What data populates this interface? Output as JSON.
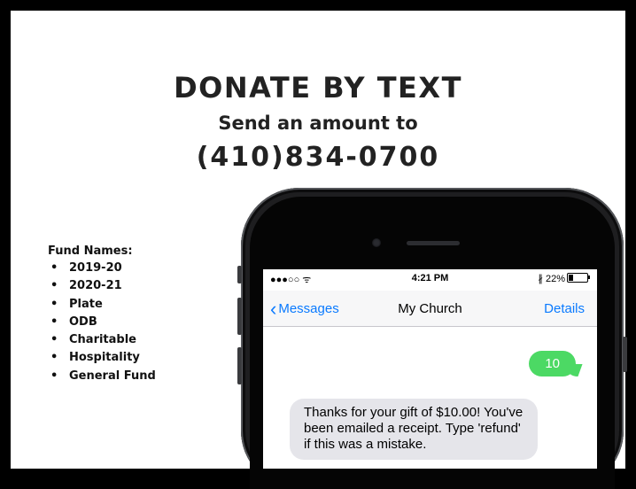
{
  "slide": {
    "heading": "DONATE BY TEXT",
    "subheading": "Send an amount to",
    "phone_number": "(410)834-0700"
  },
  "funds": {
    "title": "Fund Names:",
    "items": [
      "2019-20",
      "2020-21",
      "Plate",
      "ODB",
      "Charitable",
      "Hospitality",
      "General Fund"
    ]
  },
  "phone_screen": {
    "status": {
      "signal": "●●●○○ ᯤ",
      "time": "4:21 PM",
      "battery": "∦ 22%"
    },
    "nav": {
      "back_label": "Messages",
      "title": "My Church",
      "details_label": "Details"
    },
    "messages": {
      "outgoing": "10",
      "incoming": "Thanks for your gift of $10.00! You've been emailed a receipt. Type 'refund' if this was a mistake."
    }
  },
  "colors": {
    "ios_blue": "#0a7aff",
    "sent_bubble": "#4cd964",
    "received_bubble": "#e5e5ea",
    "phone_body": "#1e1e20"
  }
}
